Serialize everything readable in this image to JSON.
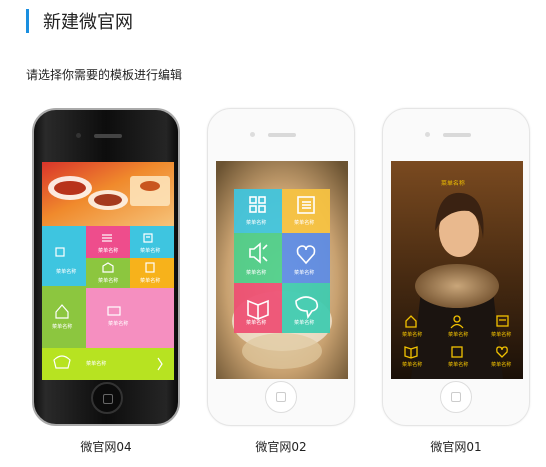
{
  "header": {
    "title": "新建微官网"
  },
  "instructions": "请选择你需要的模板进行编辑",
  "templates": [
    {
      "name": "微官网04",
      "menu_label": "菜单名称"
    },
    {
      "name": "微官网02",
      "menu_label": "菜单名称"
    },
    {
      "name": "微官网01",
      "menu_label": "菜单名称"
    }
  ],
  "colors": {
    "accent": "#1a8fe0",
    "tpl4_cyan": "#3ec5e0",
    "tpl4_pink": "#ee4d8c",
    "tpl4_yellow": "#f7b21b",
    "tpl4_green": "#8cc63f",
    "tpl4_lime": "#b7e321",
    "tpl4_light_pink": "#f58fc0"
  }
}
